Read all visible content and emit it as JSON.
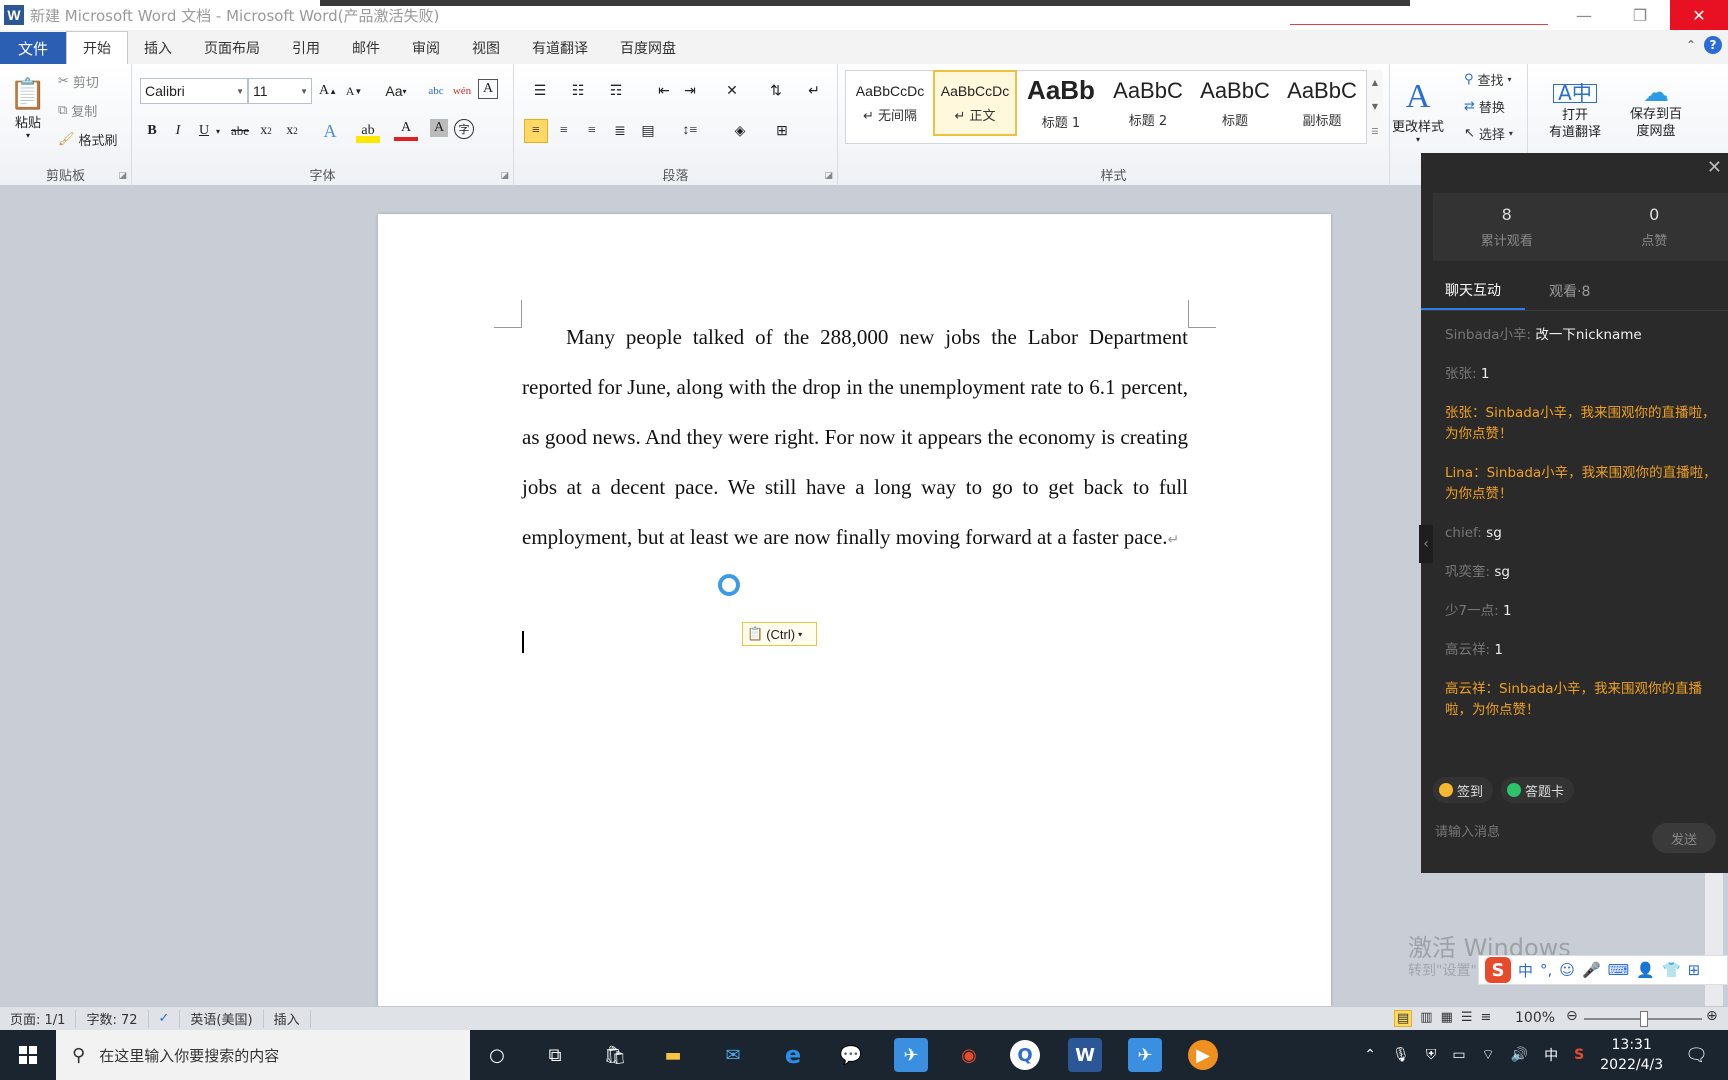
{
  "window": {
    "title": "新建 Microsoft Word 文档 - Microsoft Word(产品激活失败)",
    "app_logo": "W"
  },
  "menu": {
    "file": "文件",
    "tabs": [
      "开始",
      "插入",
      "页面布局",
      "引用",
      "邮件",
      "审阅",
      "视图",
      "有道翻译",
      "百度网盘"
    ],
    "active_tab": "开始"
  },
  "ribbon": {
    "clipboard": {
      "label": "剪贴板",
      "paste": "粘贴",
      "cut": "剪切",
      "copy": "复制",
      "format_painter": "格式刷"
    },
    "font": {
      "label": "字体",
      "name": "Calibri",
      "size": "11",
      "change_case": "Aa",
      "wen": "wén 变"
    },
    "paragraph": {
      "label": "段落"
    },
    "styles": {
      "label": "样式",
      "items": [
        {
          "sample": "AaBbCcDc",
          "name": "↵ 无间隔"
        },
        {
          "sample": "AaBbCcDc",
          "name": "↵ 正文"
        },
        {
          "sample": "AaBb",
          "name": "标题 1"
        },
        {
          "sample": "AaBbC",
          "name": "标题 2"
        },
        {
          "sample": "AaBbC",
          "name": "标题"
        },
        {
          "sample": "AaBbC",
          "name": "副标题"
        }
      ],
      "change_styles": "更改样式"
    },
    "editing": {
      "find": "查找",
      "replace": "替换",
      "select": "选择"
    },
    "youdao": {
      "line1": "打开",
      "line2": "有道翻译"
    },
    "baidu": {
      "line1": "保存到百",
      "line2": "度网盘"
    }
  },
  "document": {
    "paragraph": "Many people talked of the 288,000 new jobs the Labor Department reported for June, along with the drop in the unemployment rate to 6.1 percent, as good news. And they were right. For now it appears the economy is creating jobs at a decent pace. We still have a long way to go to get back to full employment, but at least we are now finally moving forward at a faster pace.",
    "paste_options": "(Ctrl)"
  },
  "chat": {
    "stats": [
      {
        "num": "8",
        "label": "累计观看"
      },
      {
        "num": "0",
        "label": "点赞"
      }
    ],
    "tabs": [
      "聊天互动",
      "观看·8"
    ],
    "messages": [
      {
        "name": "Sinbada小辛:",
        "text": "改一下nickname",
        "type": "normal"
      },
      {
        "name": "张张:",
        "text": "1",
        "type": "normal"
      },
      {
        "name": "",
        "text": "张张：Sinbada小辛，我来围观你的直播啦，为你点赞！",
        "type": "gift"
      },
      {
        "name": "",
        "text": "Lina：Sinbada小辛，我来围观你的直播啦，为你点赞！",
        "type": "gift"
      },
      {
        "name": "chief:",
        "text": "sg",
        "type": "normal"
      },
      {
        "name": "巩奕奎:",
        "text": "sg",
        "type": "normal"
      },
      {
        "name": "少7一点:",
        "text": "1",
        "type": "normal"
      },
      {
        "name": "高云祥:",
        "text": "1",
        "type": "normal"
      },
      {
        "name": "",
        "text": "高云祥：Sinbada小辛，我来围观你的直播啦，为你点赞！",
        "type": "gift"
      }
    ],
    "pills": [
      "签到",
      "答题卡"
    ],
    "input_placeholder": "请输入消息",
    "send": "发送"
  },
  "watermark": {
    "line1": "激活 Windows",
    "line2": "转到\"设置\"以激活 Windows。"
  },
  "ime": {
    "mode": "中"
  },
  "status": {
    "page": "页面: 1/1",
    "words": "字数: 72",
    "language": "英语(美国)",
    "mode": "插入",
    "zoom": "100%"
  },
  "taskbar": {
    "search_placeholder": "在这里输入你要搜索的内容",
    "ime": "中",
    "time": "13:31",
    "date": "2022/4/3"
  },
  "colors": {
    "file_tab": "#2b5fb3",
    "chat_bg": "#2a2a2a",
    "gift_text": "#f0a020",
    "taskbar": "#1b2530"
  }
}
